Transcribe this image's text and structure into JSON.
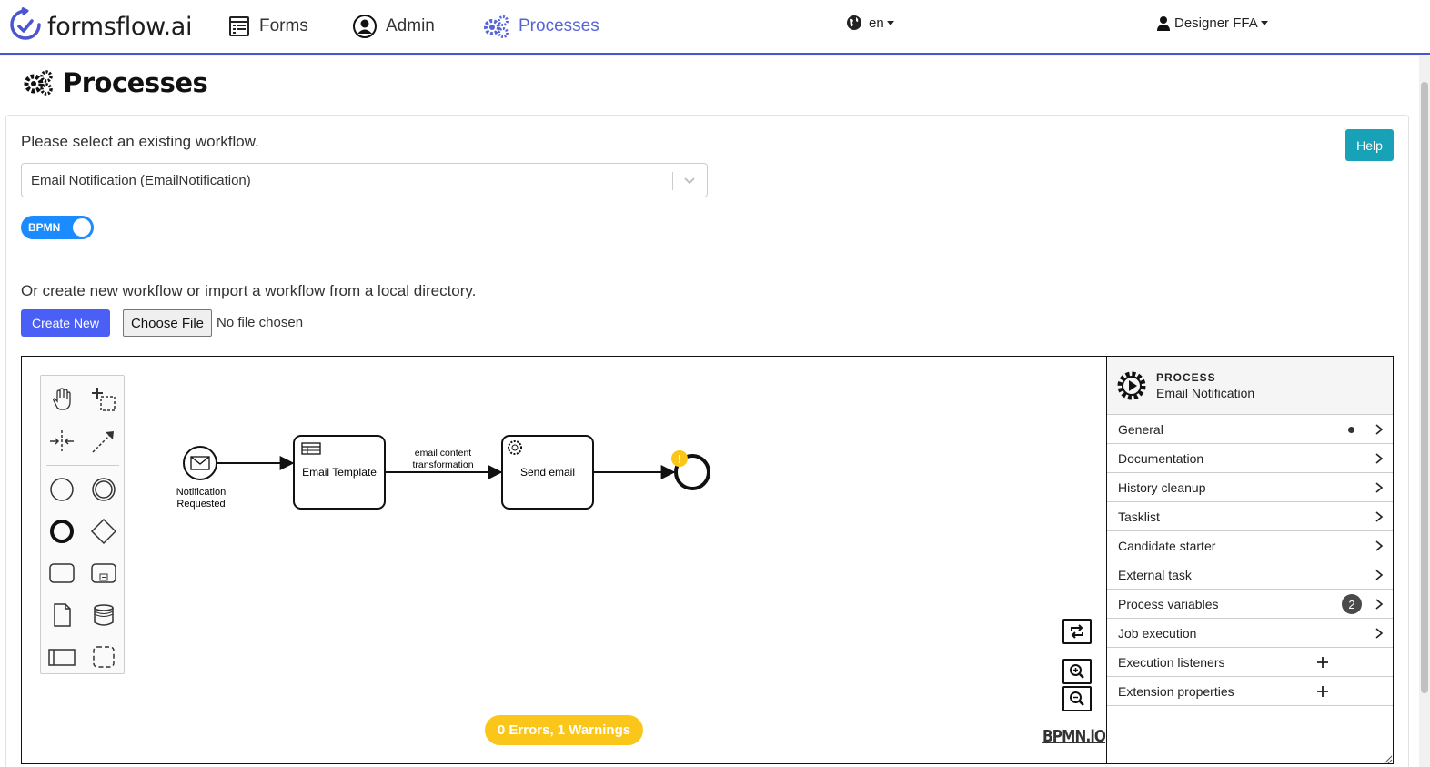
{
  "navbar": {
    "brand": "formsflow.ai",
    "items": [
      {
        "label": "Forms",
        "icon": "forms-list-icon"
      },
      {
        "label": "Admin",
        "icon": "user-circle-icon"
      },
      {
        "label": "Processes",
        "icon": "gears-icon",
        "active": true
      }
    ],
    "language": "en",
    "user": "Designer FFA",
    "accent_color": "#5664d9"
  },
  "page": {
    "title": "Processes",
    "select_label": "Please select an existing workflow.",
    "selected_workflow": "Email Notification (EmailNotification)",
    "help_label": "Help",
    "toggle_label": "BPMN",
    "toggle_on": true,
    "create_label": "Or create new workflow or import a workflow from a local directory.",
    "create_button": "Create New",
    "choose_file_button": "Choose File",
    "file_status": "No file chosen"
  },
  "diagram": {
    "start_event": {
      "label_line1": "Notification",
      "label_line2": "Requested"
    },
    "task1": {
      "label": "Email Template"
    },
    "flow_label_line1": "email content",
    "flow_label_line2": "transformation",
    "task2": {
      "label": "Send email"
    },
    "warning_mark": "!",
    "linting": "0 Errors, 1 Warnings",
    "watermark": "BPMN.iO"
  },
  "properties": {
    "type": "PROCESS",
    "name": "Email Notification",
    "groups": [
      {
        "label": "General",
        "kind": "arrow",
        "dot": true
      },
      {
        "label": "Documentation",
        "kind": "arrow"
      },
      {
        "label": "History cleanup",
        "kind": "arrow"
      },
      {
        "label": "Tasklist",
        "kind": "arrow"
      },
      {
        "label": "Candidate starter",
        "kind": "arrow"
      },
      {
        "label": "External task",
        "kind": "arrow"
      },
      {
        "label": "Process variables",
        "kind": "arrow",
        "count": "2"
      },
      {
        "label": "Job execution",
        "kind": "arrow"
      },
      {
        "label": "Execution listeners",
        "kind": "plus"
      },
      {
        "label": "Extension properties",
        "kind": "plus"
      }
    ]
  }
}
